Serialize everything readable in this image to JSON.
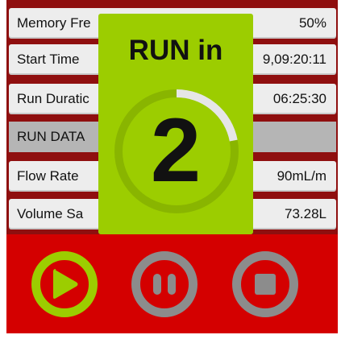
{
  "rows": [
    {
      "label": "Memory Fre",
      "value": "50%"
    },
    {
      "label": "Start Time",
      "value": "9,09:20:11"
    },
    {
      "label": "Run Duratic",
      "value": "06:25:30"
    },
    {
      "label": "RUN DATA"
    },
    {
      "label": "Flow Rate",
      "value": "90mL/m"
    },
    {
      "label": "Volume Sa",
      "value": "73.28L"
    }
  ],
  "countdown": {
    "title": "RUN in",
    "number": "2",
    "progress": 0.22
  },
  "controls": {
    "play_icon": "play-icon",
    "pause_icon": "pause-icon",
    "stop_icon": "stop-icon"
  },
  "colors": {
    "accent_green": "#9ccd00",
    "control_red": "#d40000",
    "control_gray": "#8c8c8c"
  }
}
